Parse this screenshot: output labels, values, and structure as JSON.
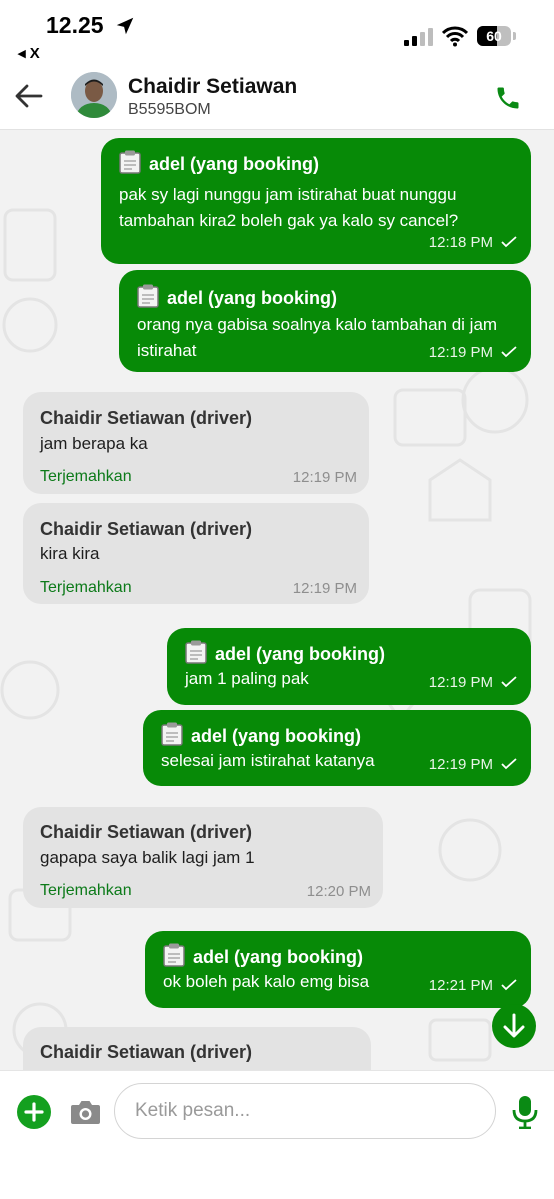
{
  "status_bar": {
    "time": "12.25",
    "back_app": "◂ X",
    "battery": "60",
    "battery_level": 0.6
  },
  "header": {
    "name": "Chaidir Setiawan",
    "plate": "B5595BOM"
  },
  "messages": [
    {
      "sender": "adel (yang booking)",
      "text": "pak sy lagi nunggu jam istirahat buat nunggu tambahan kira2 boleh gak ya kalo sy cancel?",
      "time": "12:18 PM"
    },
    {
      "sender": "adel (yang booking)",
      "text": "orang nya gabisa soalnya kalo tambahan di jam istirahat",
      "time": "12:19 PM"
    },
    {
      "sender": "Chaidir Setiawan (driver)",
      "text": "jam berapa ka",
      "time": "12:19 PM",
      "translate": "Terjemahkan"
    },
    {
      "sender": "Chaidir Setiawan (driver)",
      "text": "kira kira",
      "time": "12:19 PM",
      "translate": "Terjemahkan"
    },
    {
      "sender": "adel (yang booking)",
      "text": "jam 1 paling pak",
      "time": "12:19 PM"
    },
    {
      "sender": "adel (yang booking)",
      "text": "selesai jam istirahat katanya",
      "time": "12:19 PM"
    },
    {
      "sender": "Chaidir Setiawan (driver)",
      "text": "gapapa saya balik lagi jam 1",
      "time": "12:20 PM",
      "translate": "Terjemahkan"
    },
    {
      "sender": "adel (yang booking)",
      "text": "ok boleh pak kalo emg bisa",
      "time": "12:21 PM"
    },
    {
      "sender": "Chaidir Setiawan (driver)"
    }
  ],
  "input": {
    "placeholder": "Ketik pesan..."
  },
  "colors": {
    "outgoing_bubble": "#078a07",
    "incoming_bubble": "#e3e3e3",
    "accent": "#14a01f"
  },
  "icons": [
    "location-arrow-icon",
    "signal-icon",
    "wifi-icon",
    "battery-icon",
    "back-arrow-icon",
    "phone-icon",
    "clipboard-icon",
    "double-check-icon",
    "scroll-down-icon",
    "plus-icon",
    "camera-icon",
    "microphone-icon"
  ]
}
